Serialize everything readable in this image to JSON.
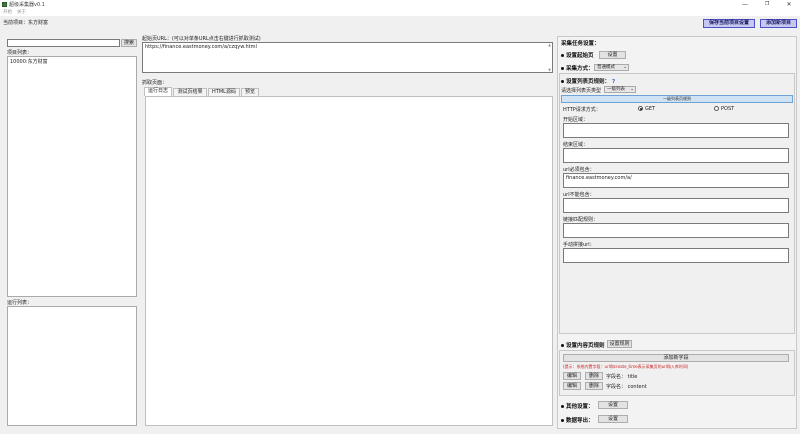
{
  "window": {
    "title": "超级采集器v0.1",
    "controls": {
      "minimize": "—",
      "maximize": "❐",
      "close": "✕"
    }
  },
  "menu": {
    "items": [
      "开始",
      "关于"
    ]
  },
  "current_project": "当前项目：东方财富",
  "toolbar": {
    "save_label": "保存当前项目设置",
    "add_label": "添加新项目"
  },
  "left": {
    "search_button": "搜索",
    "search_value": "",
    "project_list_label": "项目列表：",
    "projects": [
      "10000:东方财富"
    ],
    "run_list_label": "运行列表："
  },
  "middle": {
    "start_url_label": "起始页URL：(可以对单条URL点击右键进行抓取测试)",
    "start_url_value": "https://finance.eastmoney.com/a/czqyw.html",
    "fetch_label": "抓取页面：",
    "tabs": [
      "运行日志",
      "测试页结果",
      "HTML源码",
      "预览"
    ],
    "active_tab": 0
  },
  "right": {
    "title": "采集任务设置：",
    "start_page": {
      "label": "设置起始页",
      "button": "设置"
    },
    "collect_mode": {
      "label": "采集方式：",
      "value": "普通模式"
    },
    "list_rule": {
      "label": "设置列表页规则：",
      "help": "?",
      "type_label": "请选择列表页类型",
      "type_value": "一级列表",
      "header": "一级列表页规则",
      "method_label": "HTTP请求方式：",
      "method_get": "GET",
      "method_post": "POST",
      "method_selected": "GET",
      "start_area_label": "开始区域：",
      "start_area_value": "",
      "end_area_label": "结束区域：",
      "end_area_value": "",
      "must_include_label": "url必须包含：",
      "must_include_value": "finance.eastmoney.com/a/",
      "must_exclude_label": "url不能包含：",
      "must_exclude_value": "",
      "regex_label": "链接匹配规则：",
      "regex_value": "",
      "manual_label": "手动拼接url：",
      "manual_value": ""
    },
    "content_rule": {
      "label": "设置内容页规则",
      "button": "设置规则",
      "add_field": "添加新字段",
      "hint": "(提示：系统内置字段：url和create_time表示采集页的url和入库时间)",
      "fields": [
        {
          "edit": "编辑",
          "delete": "删除",
          "text": "字段名：  title"
        },
        {
          "edit": "编辑",
          "delete": "删除",
          "text": "字段名：  content"
        }
      ]
    },
    "other": {
      "label": "其他设置：",
      "button": "设置"
    },
    "export": {
      "label": "数据导出：",
      "button": "设置"
    }
  },
  "colors": {
    "accent_button_bg": "#c6c8f2",
    "accent_button_border": "#4b51c6",
    "list_header_bg": "#cfe3f5",
    "hint_text": "#cc2222"
  }
}
